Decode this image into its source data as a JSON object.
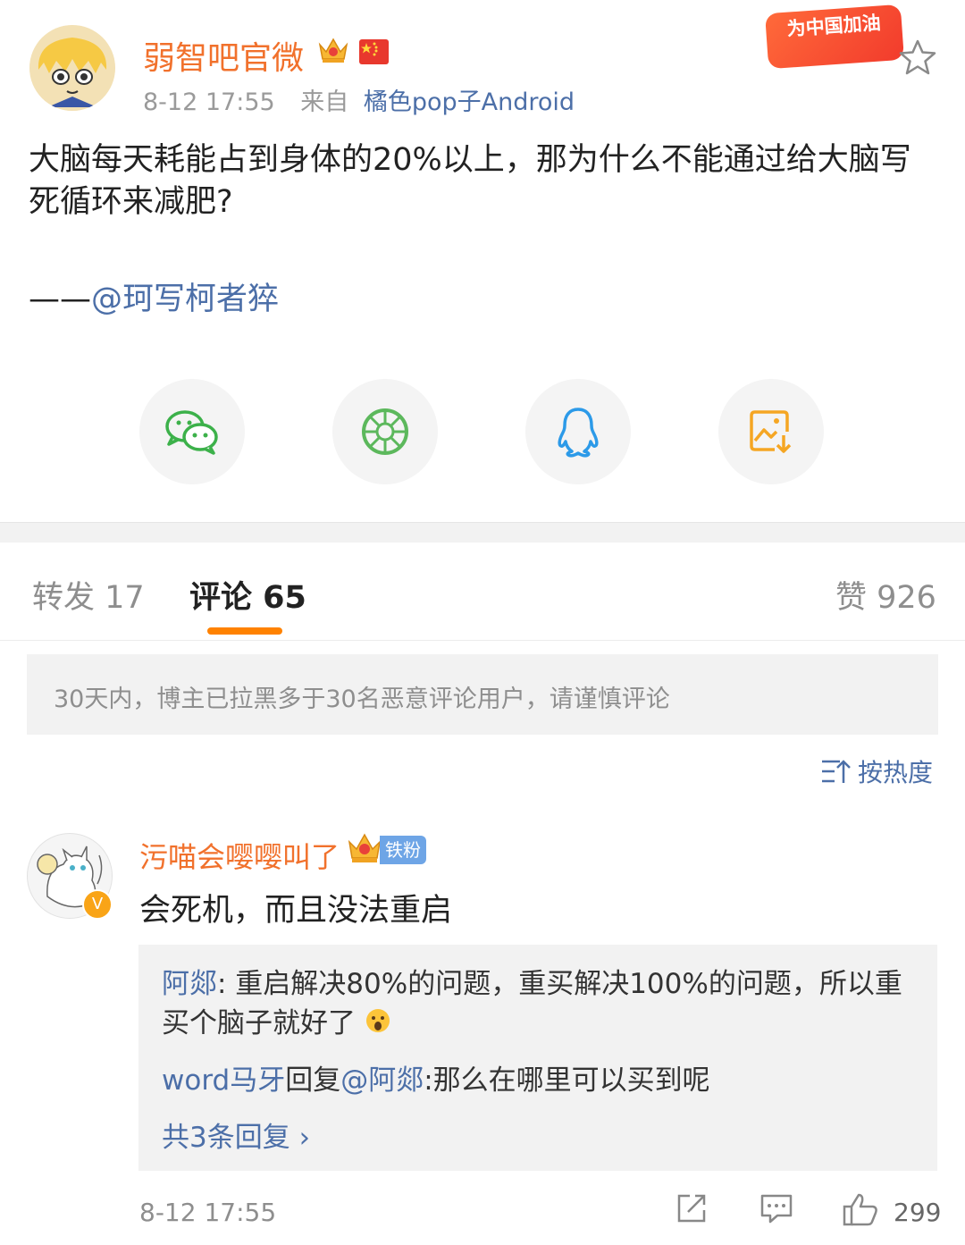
{
  "post": {
    "username": "弱智吧官微",
    "time": "8-12 17:55",
    "source_prefix": "来自",
    "source": "橘色pop子Android",
    "banner": "为中国加油",
    "text": "大脑每天耗能占到身体的20%以上，那为什么不能通过给大脑写死循环来减肥?",
    "sig_prefix": "——",
    "sig_mention": "@珂写柯者猝"
  },
  "share_icons": [
    "wechat-icon",
    "moments-icon",
    "qq-icon",
    "save-image-icon"
  ],
  "tabs": [
    {
      "label": "转发 17"
    },
    {
      "label": "评论 65"
    },
    {
      "label": "赞 926"
    }
  ],
  "notice": "30天内，博主已拉黑多于30名恶意评论用户，请谨慎评论",
  "sort_label": "按热度",
  "comment": {
    "username": "污喵会嘤嘤叫了",
    "badge": "铁粉",
    "text": "会死机，而且没法重启",
    "reply1_user": "阿郯",
    "reply1_text": ": 重启解决80%的问题，重买解决100%的问题，所以重买个脑子就好了",
    "reply2_user": "word马牙",
    "reply2_mid": "回复",
    "reply2_mention": "@阿郯",
    "reply2_text": ":那么在哪里可以买到呢",
    "more_replies": "共3条回复 ›",
    "time": "8-12 17:55",
    "likes": "299"
  }
}
